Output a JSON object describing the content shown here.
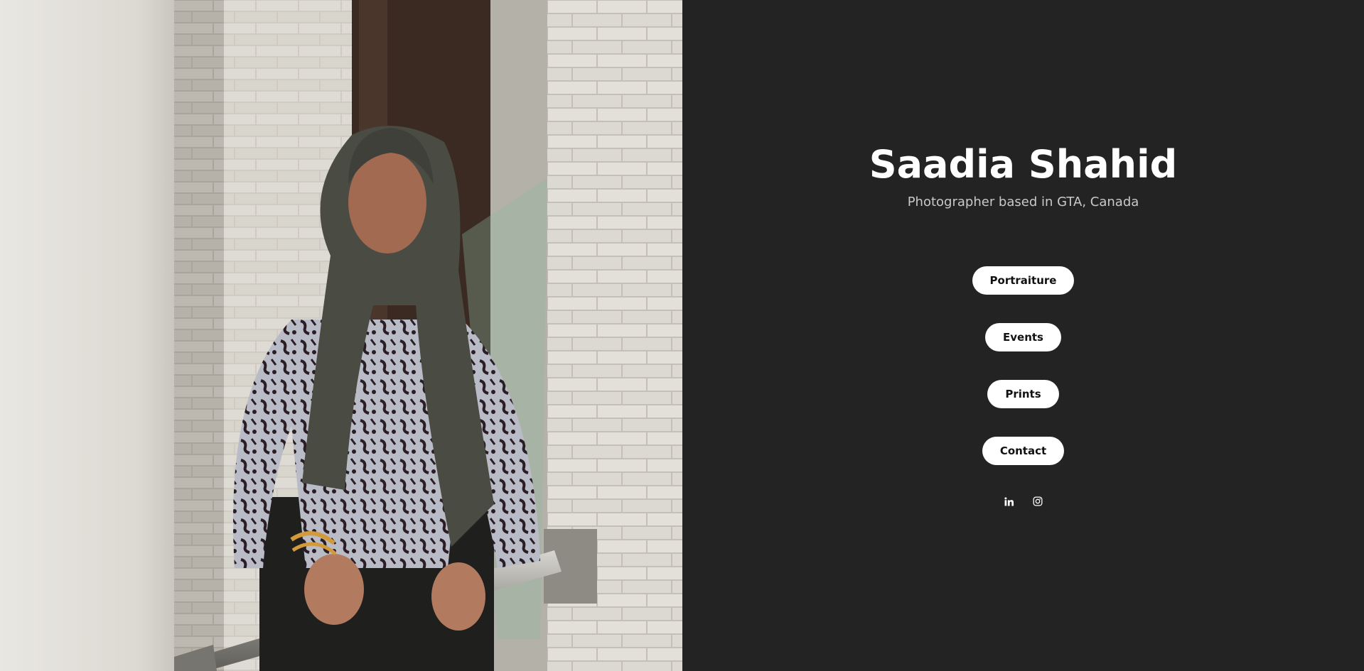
{
  "site": {
    "name": "Saadia Shahid",
    "tagline": "Photographer based in GTA, Canada"
  },
  "nav": {
    "items": [
      {
        "label": "Portraiture"
      },
      {
        "label": "Events"
      },
      {
        "label": "Prints"
      },
      {
        "label": "Contact"
      }
    ]
  },
  "social": {
    "items": [
      {
        "icon": "linkedin-icon"
      },
      {
        "icon": "instagram-icon"
      }
    ]
  },
  "colors": {
    "background": "#232323",
    "title": "#ffffff",
    "subtitle": "#c9c9c9",
    "button_bg": "#ffffff",
    "button_text": "#111111"
  }
}
